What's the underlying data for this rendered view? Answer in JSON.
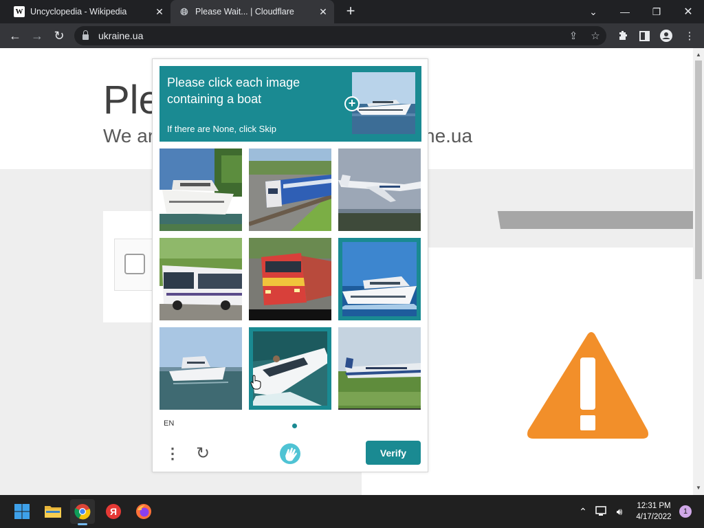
{
  "browser": {
    "tabs": [
      {
        "title": "Uncyclopedia - Wikipedia",
        "favicon": "wikipedia-icon",
        "active": false
      },
      {
        "title": "Please Wait... | Cloudflare",
        "favicon": "globe-icon",
        "active": true
      }
    ],
    "address": "ukraine.ua"
  },
  "page": {
    "heading": "Ple",
    "subheading_left": "We ar",
    "subheading_right": "ne.ua"
  },
  "captcha": {
    "prompt": "Please click each image containing a boat",
    "prompt_sub": "If there are None, click Skip",
    "language": "EN",
    "verify_label": "Verify",
    "accent": "#1a8a92",
    "tiles": [
      {
        "subject": "boat",
        "selected": false
      },
      {
        "subject": "train",
        "selected": false
      },
      {
        "subject": "airplane",
        "selected": false
      },
      {
        "subject": "bus",
        "selected": false
      },
      {
        "subject": "train",
        "selected": false
      },
      {
        "subject": "boat",
        "selected": true
      },
      {
        "subject": "boat",
        "selected": false
      },
      {
        "subject": "boat",
        "selected": true
      },
      {
        "subject": "airplane",
        "selected": false
      }
    ]
  },
  "taskbar": {
    "time": "12:31 PM",
    "date": "4/17/2022",
    "notification_count": "1"
  }
}
